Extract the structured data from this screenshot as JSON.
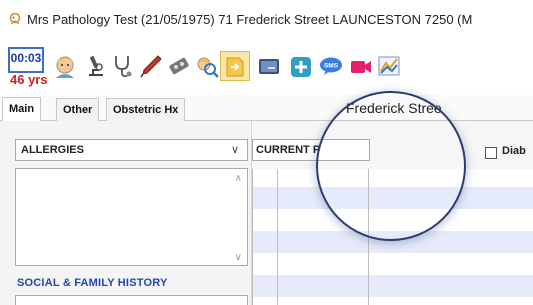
{
  "window": {
    "title": "Mrs Pathology Test (21/05/1975) 71 Frederick Street LAUNCESTON 7250 (M",
    "title_icon": "app-logo-icon"
  },
  "toolbar": {
    "timer": "00:03",
    "age": "46 yrs",
    "icons": [
      "patient-face-icon",
      "microscope-icon",
      "stethoscope-icon",
      "pen-icon",
      "tape-icon",
      "patient-search-icon",
      "document-arrow-icon",
      "image-card-icon",
      "plus-icon",
      "sms-icon",
      "video-icon",
      "chart-icon"
    ]
  },
  "tabs": [
    {
      "label": "Main",
      "active": true
    },
    {
      "label": "Other",
      "active": false
    },
    {
      "label": "Obstetric Hx",
      "active": false
    }
  ],
  "magnified": {
    "header": "Frederick Stree"
  },
  "left_panel": {
    "allergies_label": "ALLERGIES",
    "social_history_label": "SOCIAL & FAMILY HISTORY"
  },
  "right_panel": {
    "current_label": "CURRENT P",
    "diabetes_label": "Diab"
  },
  "colors": {
    "accent_blue": "#1f47b8",
    "age_red": "#d21f1f",
    "grid_stripe": "#e6ebfb"
  }
}
